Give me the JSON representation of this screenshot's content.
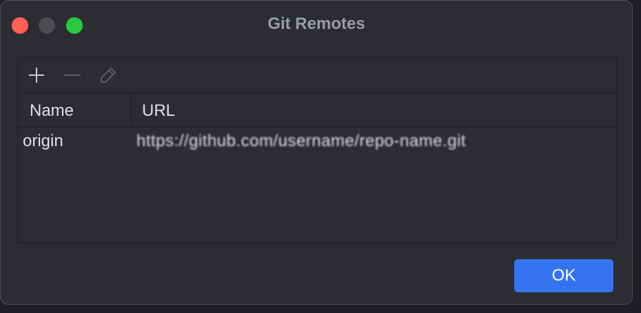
{
  "window": {
    "title": "Git Remotes"
  },
  "titlebar": {
    "controls": [
      {
        "name": "close",
        "color": "#ff5f57"
      },
      {
        "name": "minimize",
        "color": "#4b4d51"
      },
      {
        "name": "zoom",
        "color": "#28c840"
      }
    ]
  },
  "toolbar": {
    "add_icon": "plus-icon",
    "remove_icon": "minus-icon",
    "edit_icon": "pencil-icon"
  },
  "table": {
    "columns": [
      "Name",
      "URL"
    ],
    "rows": [
      {
        "name": "origin",
        "url": "https://github.com/username/repo-name.git"
      }
    ]
  },
  "footer": {
    "ok_label": "OK"
  },
  "colors": {
    "accent": "#3574f0",
    "background": "#2b2d30"
  }
}
